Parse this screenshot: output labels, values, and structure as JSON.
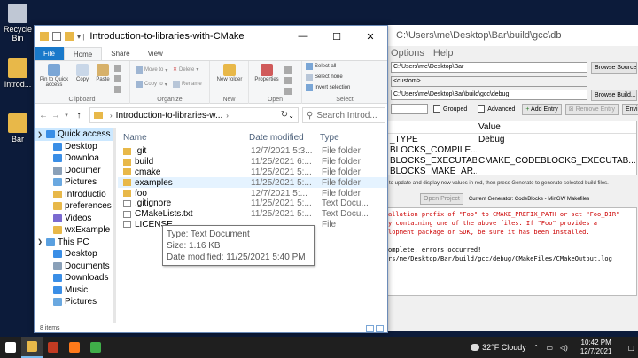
{
  "desktop": {
    "icons": [
      {
        "label": "Recycle Bin",
        "color": "#bfc7d4"
      },
      {
        "label": "Introd...",
        "color": "#e8b849"
      },
      {
        "label": "Bar",
        "color": "#e8b849"
      }
    ]
  },
  "cmake": {
    "title": "C:\\Users\\me\\Desktop\\Bar\\build\\gcc\\db",
    "menu": [
      "Options",
      "Help"
    ],
    "source_path": "C:\\Users\\me\\Desktop\\Bar",
    "browse_source": "Browse Source...",
    "preset": "<custom>",
    "build_path": "C:\\Users\\me\\Desktop\\Bar\\build\\gcc\\debug",
    "browse_build": "Browse Build...",
    "grouped": "Grouped",
    "advanced": "Advanced",
    "add_entry": "Add Entry",
    "remove_entry": "Remove Entry",
    "environment": "Environment...",
    "table_header_value": "Value",
    "rows": [
      {
        "name": "_TYPE",
        "value": "Debug"
      },
      {
        "name": "BLOCKS_COMPILE...",
        "value": ""
      },
      {
        "name": "BLOCKS_EXECUTAB...",
        "value": "CMAKE_CODEBLOCKS_EXECUTAB..."
      },
      {
        "name": "BLOCKS_MAKE_AR...",
        "value": ""
      }
    ],
    "hint": "to update and display new values in red, then press Generate to generate selected build files.",
    "open_project": "Open Project",
    "generator": "Current Generator: CodeBlocks - MinGW Makefiles",
    "output": [
      {
        "text": "allation prefix of \"Foo\" to CMAKE_PREFIX_PATH or set \"Foo_DIR\"",
        "red": true
      },
      {
        "text": "y containing one of the above files.  If \"Foo\" provides a",
        "red": true
      },
      {
        "text": "lopment package or SDK, be sure it has been installed.",
        "red": true
      },
      {
        "text": "",
        "red": false
      },
      {
        "text": "omplete, errors occurred!",
        "red": false
      },
      {
        "text": "rs/me/Desktop/Bar/build/gcc/debug/CMakeFiles/CMakeOutput.log",
        "red": false
      }
    ]
  },
  "explorer": {
    "title": "Introduction-to-libraries-with-CMake",
    "tabs": [
      "File",
      "Home",
      "Share",
      "View"
    ],
    "ribbon": {
      "clipboard": {
        "label": "Clipboard",
        "pin": "Pin to Quick access",
        "copy": "Copy",
        "paste": "Paste"
      },
      "organize": {
        "label": "Organize",
        "move_to": "Move to",
        "copy_to": "Copy to",
        "delete": "Delete",
        "rename": "Rename"
      },
      "new": {
        "label": "New",
        "new_folder": "New folder"
      },
      "open": {
        "label": "Open",
        "properties": "Properties"
      },
      "select": {
        "label": "Select",
        "select_all": "Select all",
        "select_none": "Select none",
        "invert": "Invert selection"
      }
    },
    "address": {
      "folder": "Introduction-to-libraries-w..."
    },
    "search_placeholder": "Search Introd...",
    "nav": [
      {
        "label": "Quick access",
        "arrow": "❯",
        "icon": "#3a8ee6",
        "level": 0,
        "selected": true
      },
      {
        "label": "Desktop",
        "arrow": "",
        "icon": "#3a8ee6",
        "level": 1
      },
      {
        "label": "Downloa",
        "arrow": "",
        "icon": "#3a8ee6",
        "level": 1
      },
      {
        "label": "Documer",
        "arrow": "",
        "icon": "#8aa0b8",
        "level": 1
      },
      {
        "label": "Pictures",
        "arrow": "",
        "icon": "#6aa8e0",
        "level": 1
      },
      {
        "label": "Introductio",
        "arrow": "",
        "icon": "#e8b849",
        "level": 1
      },
      {
        "label": "preferences",
        "arrow": "",
        "icon": "#e8b849",
        "level": 1
      },
      {
        "label": "Videos",
        "arrow": "",
        "icon": "#7a6ad0",
        "level": 1
      },
      {
        "label": "wxExample",
        "arrow": "",
        "icon": "#e8b849",
        "level": 1
      },
      {
        "label": "This PC",
        "arrow": "❯",
        "icon": "#5aa0e0",
        "level": 0
      },
      {
        "label": "Desktop",
        "arrow": "",
        "icon": "#3a8ee6",
        "level": 1
      },
      {
        "label": "Documents",
        "arrow": "",
        "icon": "#8aa0b8",
        "level": 1
      },
      {
        "label": "Downloads",
        "arrow": "",
        "icon": "#3a8ee6",
        "level": 1
      },
      {
        "label": "Music",
        "arrow": "",
        "icon": "#3a8ee6",
        "level": 1
      },
      {
        "label": "Pictures",
        "arrow": "",
        "icon": "#6aa8e0",
        "level": 1
      }
    ],
    "columns": {
      "name": "Name",
      "date": "Date modified",
      "type": "Type"
    },
    "files": [
      {
        "name": ".git",
        "date": "12/7/2021 5:3...",
        "type": "File folder",
        "kind": "folder"
      },
      {
        "name": "build",
        "date": "11/25/2021 6:...",
        "type": "File folder",
        "kind": "folder"
      },
      {
        "name": "cmake",
        "date": "11/25/2021 5:...",
        "type": "File folder",
        "kind": "folder"
      },
      {
        "name": "examples",
        "date": "11/25/2021 5:...",
        "type": "File folder",
        "kind": "folder",
        "hover": true
      },
      {
        "name": "foo",
        "date": "12/7/2021 5:...",
        "type": "File folder",
        "kind": "folder"
      },
      {
        "name": ".gitignore",
        "date": "11/25/2021 5:...",
        "type": "Text Docu...",
        "kind": "file"
      },
      {
        "name": "CMakeLists.txt",
        "date": "11/25/2021 5:...",
        "type": "Text Docu...",
        "kind": "file"
      },
      {
        "name": "LICENSE",
        "date": "",
        "type": "File",
        "kind": "file"
      }
    ],
    "tooltip": {
      "type": "Type: Text Document",
      "size": "Size: 1.16 KB",
      "modified": "Date modified: 11/25/2021 5:40 PM"
    },
    "status": "8 items"
  },
  "taskbar": {
    "icons": [
      {
        "name": "windows-start-icon",
        "color": "#ffffff"
      },
      {
        "name": "file-explorer-icon",
        "color": "#e8b849"
      },
      {
        "name": "app-icon",
        "color": "#c23b22"
      },
      {
        "name": "firefox-icon",
        "color": "#ff7a1a"
      },
      {
        "name": "cmake-icon",
        "color": "#3fae49"
      }
    ],
    "weather": "32°F  Cloudy",
    "time": "10:42 PM",
    "date": "12/7/2021"
  }
}
